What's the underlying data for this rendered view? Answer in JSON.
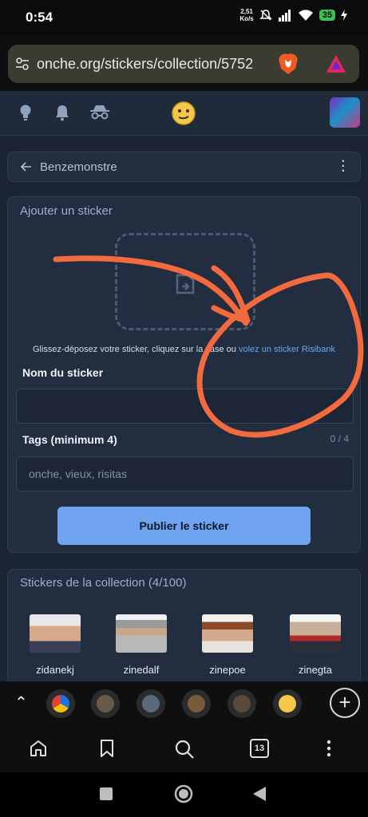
{
  "status_bar": {
    "time": "0:54",
    "net_speed_value": "2,51",
    "net_speed_unit": "Ko/s",
    "battery": "35"
  },
  "browser": {
    "url": "onche.org/stickers/collection/5752",
    "tab_count": "13"
  },
  "breadcrumb": {
    "title": "Benzemonstre"
  },
  "add_sticker": {
    "title": "Ajouter un sticker",
    "help_text": "Glissez-déposez votre sticker, cliquez sur la case ou ",
    "help_link": "volez un sticker Risibank",
    "name_label": "Nom du sticker",
    "name_value": "",
    "tags_label": "Tags (minimum 4)",
    "tags_counter": "0 / 4",
    "tags_placeholder": "onche, vieux, risitas",
    "publish_label": "Publier le sticker"
  },
  "collection": {
    "title": "Stickers de la collection (4/100)",
    "stickers": [
      {
        "name": "zidanekj"
      },
      {
        "name": "zinedalf"
      },
      {
        "name": "zinepoe"
      },
      {
        "name": "zinegta"
      }
    ]
  },
  "colors": {
    "accent": "#6ea4f0",
    "annotation": "#f26a3d",
    "background": "#1a2433",
    "card": "#222e40"
  }
}
